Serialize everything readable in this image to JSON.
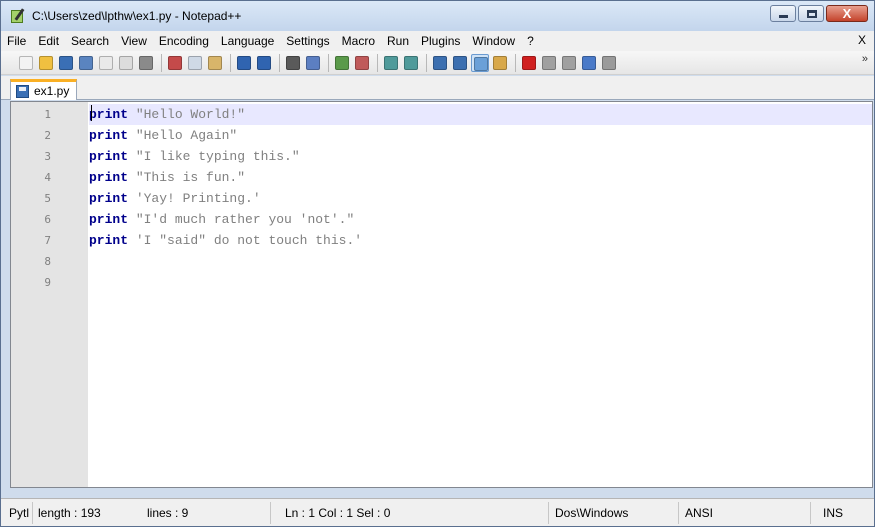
{
  "window": {
    "title": "C:\\Users\\zed\\lpthw\\ex1.py - Notepad++",
    "close_glyph": "X"
  },
  "menu": {
    "items": [
      "File",
      "Edit",
      "Search",
      "View",
      "Encoding",
      "Language",
      "Settings",
      "Macro",
      "Run",
      "Plugins",
      "Window",
      "?"
    ],
    "close_label": "X"
  },
  "toolbar": {
    "more_glyph": "»",
    "buttons": [
      {
        "name": "new-file-icon",
        "color": "#f3f3f3"
      },
      {
        "name": "open-file-icon",
        "color": "#f0c040"
      },
      {
        "name": "save-icon",
        "color": "#3a6fb5"
      },
      {
        "name": "save-all-icon",
        "color": "#5a84c0"
      },
      {
        "name": "close-file-icon",
        "color": "#e9e9e9"
      },
      {
        "name": "close-all-icon",
        "color": "#dcdcdc"
      },
      {
        "name": "print-icon",
        "color": "#8a8a8a"
      },
      {
        "name": "sep"
      },
      {
        "name": "cut-icon",
        "color": "#c44a4a"
      },
      {
        "name": "copy-icon",
        "color": "#cfd9e6"
      },
      {
        "name": "paste-icon",
        "color": "#d8b56a"
      },
      {
        "name": "sep"
      },
      {
        "name": "undo-icon",
        "color": "#3064b0"
      },
      {
        "name": "redo-icon",
        "color": "#3064b0"
      },
      {
        "name": "sep"
      },
      {
        "name": "find-icon",
        "color": "#5a5a5a"
      },
      {
        "name": "replace-icon",
        "color": "#5c7fc2"
      },
      {
        "name": "sep"
      },
      {
        "name": "zoom-in-icon",
        "color": "#5a9a4a"
      },
      {
        "name": "zoom-out-icon",
        "color": "#c05a5a"
      },
      {
        "name": "sep"
      },
      {
        "name": "sync-vertical-icon",
        "color": "#4f9a9a"
      },
      {
        "name": "sync-horizontal-icon",
        "color": "#4f9a9a"
      },
      {
        "name": "sep"
      },
      {
        "name": "word-wrap-icon",
        "color": "#3c6fb0"
      },
      {
        "name": "show-all-chars-icon",
        "color": "#3c6fb0"
      },
      {
        "name": "indent-guide-icon",
        "color": "#6aa0d8",
        "active": true
      },
      {
        "name": "user-lang-icon",
        "color": "#d8a84a"
      },
      {
        "name": "sep"
      },
      {
        "name": "record-macro-icon",
        "color": "#d02020"
      },
      {
        "name": "stop-record-icon",
        "color": "#a0a0a0"
      },
      {
        "name": "play-macro-icon",
        "color": "#a0a0a0"
      },
      {
        "name": "play-multiple-icon",
        "color": "#4a7ac8"
      },
      {
        "name": "save-macro-icon",
        "color": "#9a9a9a"
      }
    ]
  },
  "tabs": [
    {
      "label": "ex1.py"
    }
  ],
  "editor": {
    "line_numbers": [
      "1",
      "2",
      "3",
      "4",
      "5",
      "6",
      "7",
      "8",
      "9"
    ],
    "lines": [
      {
        "keyword": "print",
        "string": " \"Hello World!\""
      },
      {
        "keyword": "print",
        "string": " \"Hello Again\""
      },
      {
        "keyword": "print",
        "string": " \"I like typing this.\""
      },
      {
        "keyword": "print",
        "string": " \"This is fun.\""
      },
      {
        "keyword": "print",
        "string": " 'Yay! Printing.'"
      },
      {
        "keyword": "print",
        "string": " \"I'd much rather you 'not'.\""
      },
      {
        "keyword": "print",
        "string": " 'I \"said\" do not touch this.'"
      },
      {
        "keyword": "",
        "string": ""
      },
      {
        "keyword": "",
        "string": ""
      }
    ]
  },
  "status": {
    "file_type": "Pytl",
    "length": "length : 193",
    "lines": "lines : 9",
    "cursor": "Ln : 1   Col : 1   Sel : 0",
    "eol": "Dos\\Windows",
    "encoding": "ANSI",
    "mode": "INS"
  }
}
